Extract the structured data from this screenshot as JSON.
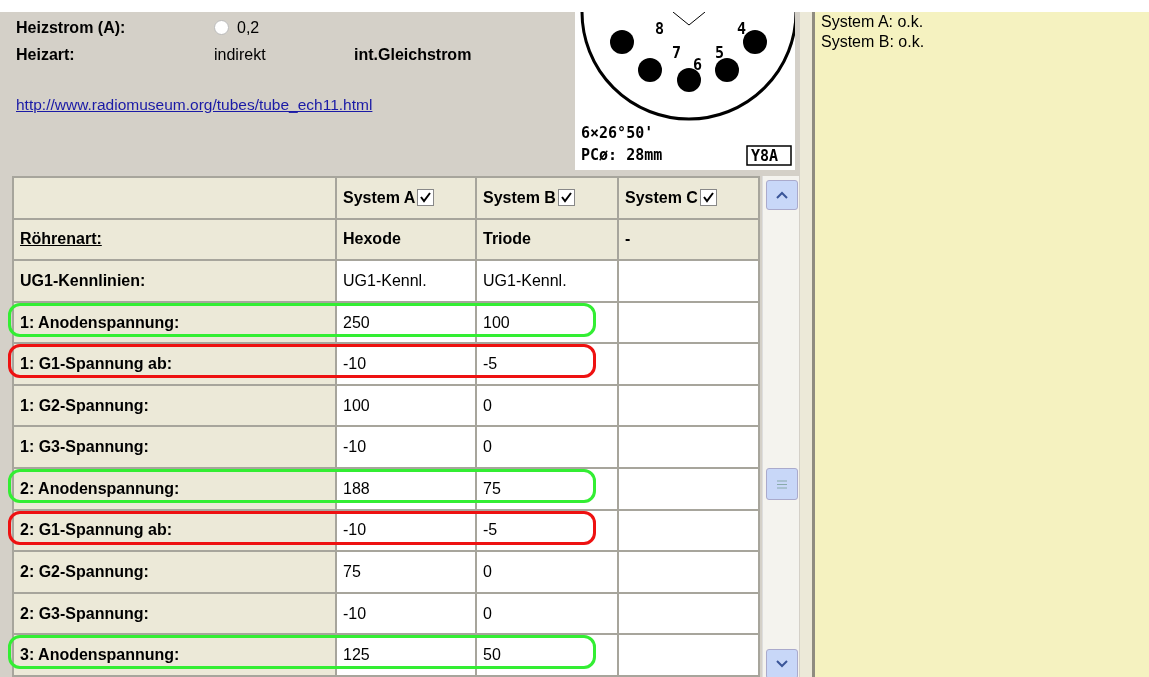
{
  "heater": {
    "current_label": "Heizstrom (A):",
    "current_checked": false,
    "current_value": "0,2",
    "type_label": "Heizart:",
    "type_value": "indirekt",
    "type_extra": "int.Gleichstrom"
  },
  "link": "http://www.radiomuseum.org/tubes/tube_ech11.html",
  "base_diagram": {
    "pins": [
      "8",
      "7",
      "6",
      "5",
      "4"
    ],
    "angle": "6×26°50'",
    "pitch": "PCø: 28mm",
    "code": "Y8A"
  },
  "table": {
    "columns": [
      {
        "label": "System A",
        "checked": true
      },
      {
        "label": "System B",
        "checked": true
      },
      {
        "label": "System C",
        "checked": true
      }
    ],
    "rows": [
      {
        "label": "Röhrenart:",
        "kind": "type",
        "values": [
          "Hexode",
          "Triode",
          "-"
        ]
      },
      {
        "label": "UG1-Kennlinien:",
        "kind": "value",
        "values": [
          "UG1-Kennl.",
          "UG1-Kennl."
        ]
      },
      {
        "label": "1: Anodenspannung:",
        "kind": "value",
        "values": [
          "250",
          "100"
        ],
        "color": "#33ee33"
      },
      {
        "label": "1: G1-Spannung ab:",
        "kind": "value",
        "values": [
          "-10",
          "-5"
        ],
        "color": "#ee1111"
      },
      {
        "label": "1: G2-Spannung:",
        "kind": "value",
        "values": [
          "100",
          "0"
        ]
      },
      {
        "label": "1: G3-Spannung:",
        "kind": "value",
        "values": [
          "-10",
          "0"
        ]
      },
      {
        "label": "2: Anodenspannung:",
        "kind": "value",
        "values": [
          "188",
          "75"
        ],
        "color": "#33ee33"
      },
      {
        "label": "2: G1-Spannung ab:",
        "kind": "value",
        "values": [
          "-10",
          "-5"
        ],
        "color": "#ee1111"
      },
      {
        "label": "2: G2-Spannung:",
        "kind": "value",
        "values": [
          "75",
          "0"
        ]
      },
      {
        "label": "2: G3-Spannung:",
        "kind": "value",
        "values": [
          "-10",
          "0"
        ]
      },
      {
        "label": "3: Anodenspannung:",
        "kind": "value",
        "values": [
          "125",
          "50"
        ],
        "color": "#33ee33"
      }
    ]
  },
  "messages": [
    "System A: o.k.",
    "System B: o.k."
  ]
}
